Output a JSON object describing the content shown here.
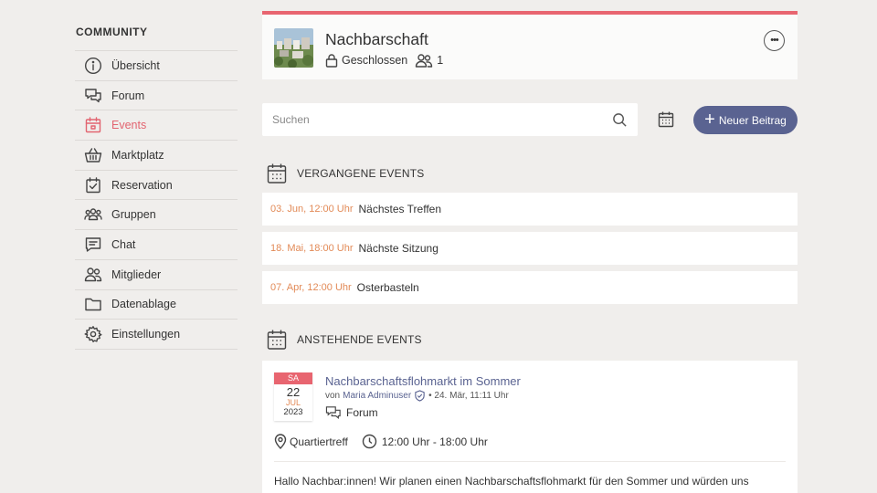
{
  "sidebar": {
    "title": "COMMUNITY",
    "items": [
      {
        "label": "Übersicht",
        "icon": "info-icon"
      },
      {
        "label": "Forum",
        "icon": "chat-bubbles-icon"
      },
      {
        "label": "Events",
        "icon": "calendar-icon",
        "active": true
      },
      {
        "label": "Marktplatz",
        "icon": "basket-icon"
      },
      {
        "label": "Reservation",
        "icon": "calendar-check-icon"
      },
      {
        "label": "Gruppen",
        "icon": "group-icon"
      },
      {
        "label": "Chat",
        "icon": "message-icon"
      },
      {
        "label": "Mitglieder",
        "icon": "members-icon"
      },
      {
        "label": "Datenablage",
        "icon": "folder-icon"
      },
      {
        "label": "Einstellungen",
        "icon": "gear-icon"
      }
    ]
  },
  "group": {
    "title": "Nachbarschaft",
    "privacy": "Geschlossen",
    "member_count": "1"
  },
  "toolbar": {
    "search_placeholder": "Suchen",
    "new_post_label": "Neuer Beitrag"
  },
  "past_events": {
    "heading": "VERGANGENE EVENTS",
    "items": [
      {
        "date": "03. Jun, 12:00 Uhr",
        "name": "Nächstes Treffen"
      },
      {
        "date": "18. Mai, 18:00 Uhr",
        "name": "Nächste Sitzung"
      },
      {
        "date": "07. Apr, 12:00 Uhr",
        "name": "Osterbasteln"
      }
    ]
  },
  "upcoming_events": {
    "heading": "ANSTEHENDE EVENTS",
    "card": {
      "badge": {
        "dow": "SA",
        "day": "22",
        "month": "JUL",
        "year": "2023"
      },
      "title": "Nachbarschaftsflohmarkt im Sommer",
      "by_prefix": "von",
      "author": "Maria Adminuser",
      "posted": "• 24. Mär, 11:11 Uhr",
      "category": "Forum",
      "location": "Quartiertreff",
      "time": "12:00 Uhr - 18:00 Uhr",
      "text": "Hallo Nachbar:innen! Wir planen einen Nachbarschaftsflohmarkt für den Sommer und würden uns"
    }
  },
  "colors": {
    "accent": "#e86570",
    "primary": "#5a6391",
    "date": "#e28a57",
    "background": "#f0eeec"
  }
}
